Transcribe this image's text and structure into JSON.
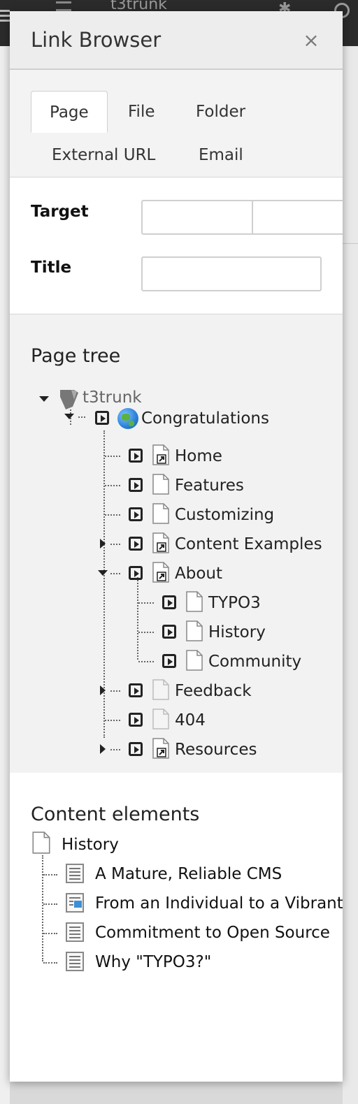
{
  "background": {
    "app_title": "t3trunk"
  },
  "modal": {
    "title": "Link Browser",
    "close_glyph": "×",
    "tabs": [
      {
        "label": "Page",
        "active": true
      },
      {
        "label": "File",
        "active": false
      },
      {
        "label": "Folder",
        "active": false
      },
      {
        "label": "External URL",
        "active": false
      },
      {
        "label": "Email",
        "active": false
      }
    ],
    "form": {
      "target_label": "Target",
      "target_value": "",
      "target_select_value": "",
      "title_label": "Title",
      "title_value": ""
    },
    "page_tree": {
      "heading": "Page tree",
      "root": "t3trunk",
      "nodes": [
        {
          "label": "Congratulations",
          "icon": "globe-icon"
        },
        {
          "label": "Home",
          "icon": "page-shortcut-icon"
        },
        {
          "label": "Features",
          "icon": "page-icon"
        },
        {
          "label": "Customizing",
          "icon": "page-icon"
        },
        {
          "label": "Content Examples",
          "icon": "page-shortcut-icon"
        },
        {
          "label": "About",
          "icon": "page-shortcut-icon"
        },
        {
          "label": "TYPO3",
          "icon": "page-icon"
        },
        {
          "label": "History",
          "icon": "page-icon"
        },
        {
          "label": "Community",
          "icon": "page-icon"
        },
        {
          "label": "Feedback",
          "icon": "page-hidden-icon"
        },
        {
          "label": "404",
          "icon": "page-hidden-icon"
        },
        {
          "label": "Resources",
          "icon": "page-shortcut-icon"
        }
      ]
    },
    "content_elements": {
      "heading": "Content elements",
      "page": "History",
      "items": [
        {
          "label": "A Mature, Reliable CMS",
          "icon": "text-element-icon"
        },
        {
          "label": "From an Individual to a Vibrant",
          "icon": "text-image-element-icon"
        },
        {
          "label": "Commitment to Open Source",
          "icon": "text-element-icon"
        },
        {
          "label": "Why \"TYPO3?\"",
          "icon": "text-element-icon"
        }
      ]
    }
  }
}
